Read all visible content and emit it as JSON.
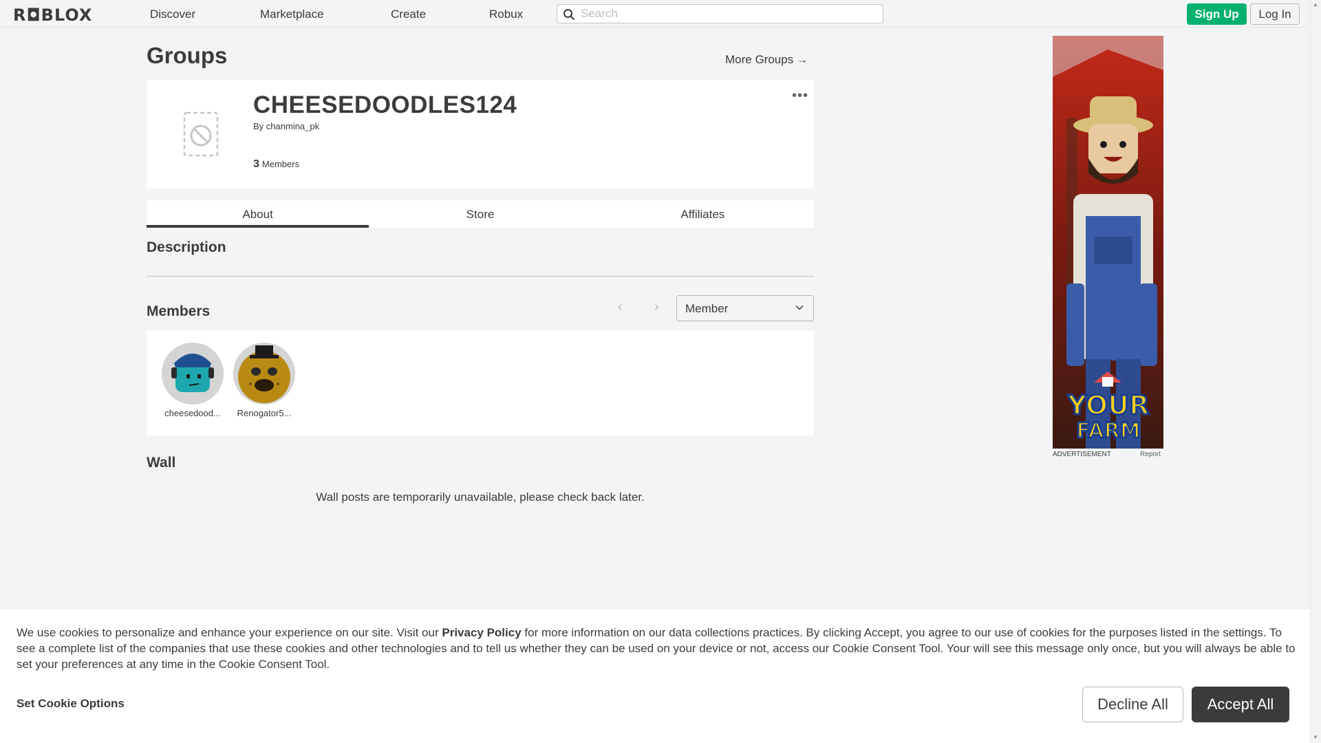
{
  "header": {
    "logo": "R◘BLOX",
    "nav": [
      "Discover",
      "Marketplace",
      "Create",
      "Robux"
    ],
    "search_placeholder": "Search",
    "signup_label": "Sign Up",
    "login_label": "Log In"
  },
  "page": {
    "title": "Groups",
    "more_groups": "More Groups"
  },
  "group": {
    "name": "CHEESEDOODLES124",
    "by_prefix": "By",
    "owner": "chanmina_pk",
    "member_count": "3",
    "members_label": "Members",
    "more_options": "•••"
  },
  "tabs": [
    "About",
    "Store",
    "Affiliates"
  ],
  "sections": {
    "description": "Description",
    "members": "Members",
    "wall": "Wall"
  },
  "members": {
    "role_filter": "Member",
    "list": [
      {
        "name": "cheesedood...",
        "avatar_color": "#1fa7b0"
      },
      {
        "name": "Renogator5...",
        "avatar_color": "#b88a14"
      }
    ]
  },
  "wall": {
    "message": "Wall posts are temporarily unavailable, please check back later."
  },
  "ad": {
    "label": "ADVERTISEMENT",
    "report": "Report",
    "logo_line1": "YOUR",
    "logo_line2": "FARM"
  },
  "cookie": {
    "text_before": "We use cookies to personalize and enhance your experience on our site. Visit our ",
    "policy_link": "Privacy Policy",
    "text_after": " for more information on our data collections practices. By clicking Accept, you agree to our use of cookies for the purposes listed in the settings. To see a complete list of the companies that use these cookies and other technologies and to tell us whether they can be used on your device or not, access our Cookie Consent Tool. Your will see this message only once, but you will always be able to set your preferences at any time in the Cookie Consent Tool.",
    "options_label": "Set Cookie Options",
    "decline_label": "Decline All",
    "accept_label": "Accept All"
  },
  "colors": {
    "brand_green": "#00b06f",
    "text": "#393b3d",
    "background": "#f2f4f5"
  }
}
